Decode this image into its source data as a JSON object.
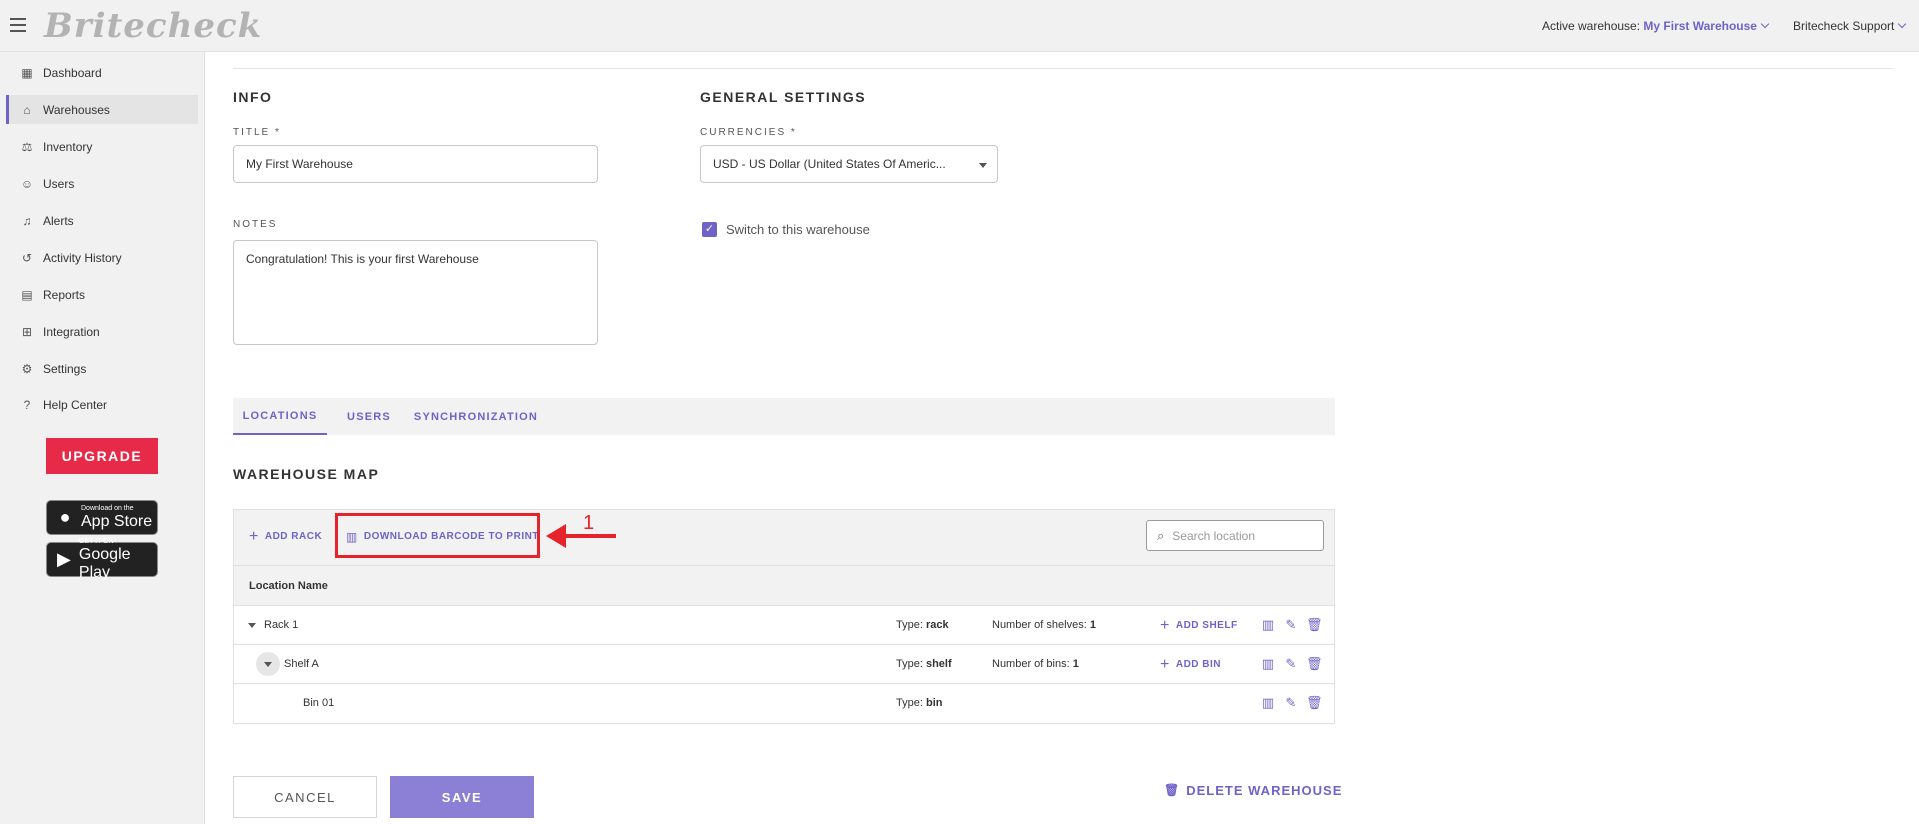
{
  "header": {
    "logo": "Britecheck",
    "active_warehouse_label": "Active warehouse:",
    "active_warehouse_value": "My First Warehouse",
    "account": "Britecheck Support"
  },
  "sidebar": {
    "items": [
      {
        "label": "Dashboard",
        "icon": "dashboard-icon",
        "active": false
      },
      {
        "label": "Warehouses",
        "icon": "warehouse-icon",
        "active": true
      },
      {
        "label": "Inventory",
        "icon": "inventory-icon",
        "active": false
      },
      {
        "label": "Users",
        "icon": "users-icon",
        "active": false
      },
      {
        "label": "Alerts",
        "icon": "bell-icon",
        "active": false
      },
      {
        "label": "Activity History",
        "icon": "history-icon",
        "active": false
      },
      {
        "label": "Reports",
        "icon": "report-icon",
        "active": false
      },
      {
        "label": "Integration",
        "icon": "integration-icon",
        "active": false
      },
      {
        "label": "Settings",
        "icon": "gear-icon",
        "active": false
      },
      {
        "label": "Help Center",
        "icon": "help-icon",
        "active": false
      }
    ],
    "upgrade": "UPGRADE",
    "app_store": {
      "small": "Download on the",
      "big": "App Store"
    },
    "google_play": {
      "small": "GET IT ON",
      "big": "Google Play"
    }
  },
  "info": {
    "title": "INFO",
    "title_label": "TITLE *",
    "title_value": "My First Warehouse",
    "notes_label": "NOTES",
    "notes_value": "Congratulation! This is your first Warehouse"
  },
  "general": {
    "title": "GENERAL SETTINGS",
    "currencies_label": "CURRENCIES *",
    "currencies_value": "USD - US Dollar (United States Of Americ...",
    "switch_label": "Switch to this warehouse",
    "switch_checked": true
  },
  "tabs": [
    "LOCATIONS",
    "USERS",
    "SYNCHRONIZATION"
  ],
  "warehouse_map": {
    "title": "WAREHOUSE MAP",
    "add_rack": "ADD RACK",
    "download_barcode": "DOWNLOAD BARCODE TO PRINT",
    "search_placeholder": "Search location",
    "column_header": "Location Name",
    "rows": [
      {
        "name": "Rack 1",
        "type_label": "Type:",
        "type": "rack",
        "count_label": "Number of shelves:",
        "count": "1",
        "add_label": "ADD SHELF"
      },
      {
        "name": "Shelf A",
        "type_label": "Type:",
        "type": "shelf",
        "count_label": "Number of bins:",
        "count": "1",
        "add_label": "ADD BIN"
      },
      {
        "name": "Bin 01",
        "type_label": "Type:",
        "type": "bin"
      }
    ]
  },
  "annotation": {
    "number": "1",
    "color": "#e5232b"
  },
  "buttons": {
    "cancel": "CANCEL",
    "save": "SAVE",
    "delete": "DELETE WAREHOUSE"
  },
  "colors": {
    "accent": "#6f63c7",
    "upgrade": "#e82a49"
  }
}
